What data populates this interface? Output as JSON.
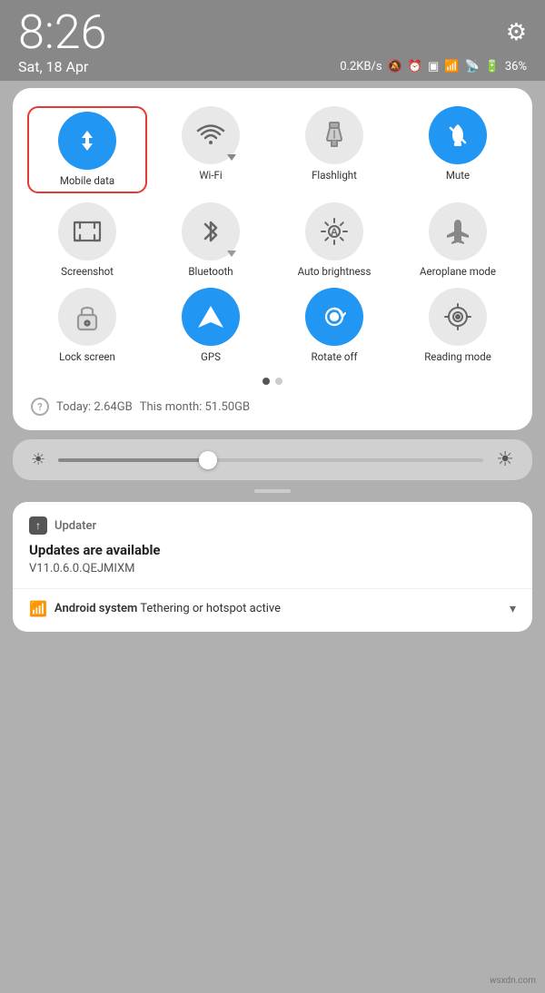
{
  "statusBar": {
    "time": "8:26",
    "date": "Sat, 18 Apr",
    "speed": "0.2KB/s",
    "battery": "36%"
  },
  "toggles": [
    {
      "id": "mobile-data",
      "label": "Mobile data",
      "active": true,
      "selected": true
    },
    {
      "id": "wifi",
      "label": "Wi-Fi",
      "active": false,
      "selected": false
    },
    {
      "id": "flashlight",
      "label": "Flashlight",
      "active": false,
      "selected": false
    },
    {
      "id": "mute",
      "label": "Mute",
      "active": true,
      "selected": false
    },
    {
      "id": "screenshot",
      "label": "Screenshot",
      "active": false,
      "selected": false
    },
    {
      "id": "bluetooth",
      "label": "Bluetooth",
      "active": false,
      "selected": false,
      "hasArrow": true
    },
    {
      "id": "auto-brightness",
      "label": "Auto brightness",
      "active": false,
      "selected": false
    },
    {
      "id": "aeroplane",
      "label": "Aeroplane mode",
      "active": false,
      "selected": false
    },
    {
      "id": "lock-screen",
      "label": "Lock screen",
      "active": false,
      "selected": false
    },
    {
      "id": "gps",
      "label": "GPS",
      "active": true,
      "selected": false
    },
    {
      "id": "rotate-off",
      "label": "Rotate off",
      "active": true,
      "selected": false
    },
    {
      "id": "reading-mode",
      "label": "Reading mode",
      "active": false,
      "selected": false
    }
  ],
  "dataUsage": {
    "today": "Today: 2.64GB",
    "thisMonth": "This month: 51.50GB"
  },
  "notification": {
    "appName": "Updater",
    "title": "Updates are available",
    "subtitle": "V11.0.6.0.QEJMIXM",
    "footer": {
      "appName": "Android system",
      "text": "Tethering or hotspot active"
    }
  },
  "watermark": "wsxdn.com"
}
